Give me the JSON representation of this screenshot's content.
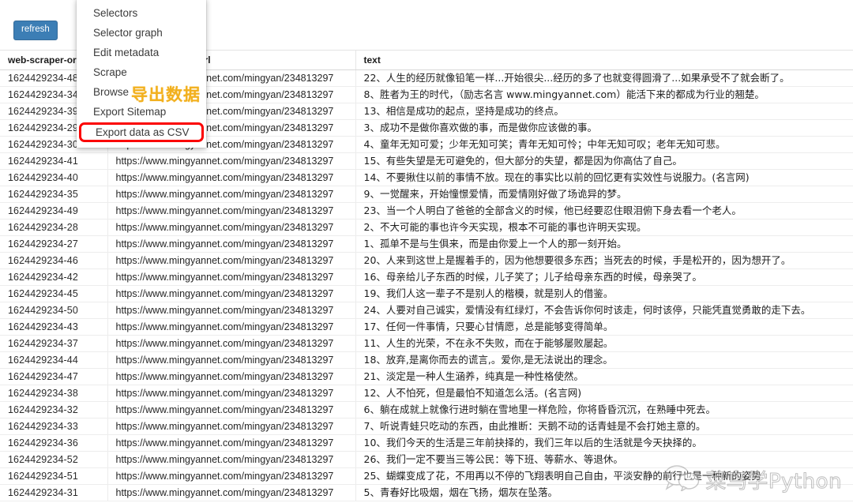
{
  "toolbar": {
    "refresh_label": "refresh"
  },
  "context_menu": {
    "items": [
      {
        "label": "Selectors",
        "highlighted": false
      },
      {
        "label": "Selector graph",
        "highlighted": false
      },
      {
        "label": "Edit metadata",
        "highlighted": false
      },
      {
        "label": "Scrape",
        "highlighted": false
      },
      {
        "label": "Browse",
        "highlighted": false
      },
      {
        "label": "Export Sitemap",
        "highlighted": false
      },
      {
        "label": "Export data as CSV",
        "highlighted": true
      }
    ],
    "highlight_color": "#fb0000"
  },
  "annotation": {
    "text": "导出数据",
    "color": "#f2b01e"
  },
  "watermark": {
    "text": "菜鸟学Python",
    "icon": "wechat-icon"
  },
  "table": {
    "columns": [
      "web-scraper-order",
      "web-scraper-start-url",
      "text"
    ],
    "rows": [
      {
        "id": "1624429234-48",
        "url": "https://www.mingyannet.com/mingyan/234813297",
        "text": "22、人生的经历就像铅笔一样...开始很尖...经历的多了也就变得圆滑了...如果承受不了就会断了。"
      },
      {
        "id": "1624429234-34",
        "url": "https://www.mingyannet.com/mingyan/234813297",
        "text": "8、胜者为王的时代，（励志名言 www.mingyannet.com）能活下来的都成为行业的翘楚。"
      },
      {
        "id": "1624429234-39",
        "url": "https://www.mingyannet.com/mingyan/234813297",
        "text": "13、相信是成功的起点，坚持是成功的终点。"
      },
      {
        "id": "1624429234-29",
        "url": "https://www.mingyannet.com/mingyan/234813297",
        "text": "3、成功不是做你喜欢做的事，而是做你应该做的事。"
      },
      {
        "id": "1624429234-30",
        "url": "https://www.mingyannet.com/mingyan/234813297",
        "text": "4、童年无知可爱；少年无知可笑；青年无知可怜；中年无知可叹；老年无知可悲。"
      },
      {
        "id": "1624429234-41",
        "url": "https://www.mingyannet.com/mingyan/234813297",
        "text": "15、有些失望是无可避免的，但大部分的失望，都是因为你高估了自己。"
      },
      {
        "id": "1624429234-40",
        "url": "https://www.mingyannet.com/mingyan/234813297",
        "text": "14、不要揪住以前的事情不放。现在的事实比以前的回忆更有实效性与说服力。(名言网)"
      },
      {
        "id": "1624429234-35",
        "url": "https://www.mingyannet.com/mingyan/234813297",
        "text": "9、一觉醒来，开始憧憬爱情，而爱情刚好做了场诡异的梦。"
      },
      {
        "id": "1624429234-49",
        "url": "https://www.mingyannet.com/mingyan/234813297",
        "text": "23、当一个人明白了爸爸的全部含义的时候，他已经要忍住眼泪俯下身去看一个老人。"
      },
      {
        "id": "1624429234-28",
        "url": "https://www.mingyannet.com/mingyan/234813297",
        "text": "2、不大可能的事也许今天实现，根本不可能的事也许明天实现。"
      },
      {
        "id": "1624429234-27",
        "url": "https://www.mingyannet.com/mingyan/234813297",
        "text": "1、孤单不是与生俱来，而是由你爱上一个人的那一刻开始。"
      },
      {
        "id": "1624429234-46",
        "url": "https://www.mingyannet.com/mingyan/234813297",
        "text": "20、人来到这世上是握着手的，因为他想要很多东西；当死去的时候，手是松开的，因为想开了。"
      },
      {
        "id": "1624429234-42",
        "url": "https://www.mingyannet.com/mingyan/234813297",
        "text": "16、母亲给儿子东西的时候，儿子笑了；儿子给母亲东西的时候，母亲哭了。"
      },
      {
        "id": "1624429234-45",
        "url": "https://www.mingyannet.com/mingyan/234813297",
        "text": "19、我们人这一辈子不是别人的楷模，就是别人的借鉴。"
      },
      {
        "id": "1624429234-50",
        "url": "https://www.mingyannet.com/mingyan/234813297",
        "text": "24、人要对自己诚实，爱情没有红绿灯，不会告诉你何时该走，何时该停，只能凭直觉勇敢的走下去。"
      },
      {
        "id": "1624429234-43",
        "url": "https://www.mingyannet.com/mingyan/234813297",
        "text": "17、任何一件事情，只要心甘情愿，总是能够变得简单。"
      },
      {
        "id": "1624429234-37",
        "url": "https://www.mingyannet.com/mingyan/234813297",
        "text": "11、人生的光荣，不在永不失败，而在于能够屡败屡起。"
      },
      {
        "id": "1624429234-44",
        "url": "https://www.mingyannet.com/mingyan/234813297",
        "text": "18、放弃,是离你而去的谎言,。爱你,是无法说出的理念。"
      },
      {
        "id": "1624429234-47",
        "url": "https://www.mingyannet.com/mingyan/234813297",
        "text": "21、淡定是一种人生涵养，纯真是一种性格使然。"
      },
      {
        "id": "1624429234-38",
        "url": "https://www.mingyannet.com/mingyan/234813297",
        "text": "12、人不怕死，但是最怕不知道怎么活。(名言网)"
      },
      {
        "id": "1624429234-32",
        "url": "https://www.mingyannet.com/mingyan/234813297",
        "text": "6、躺在成就上就像行进时躺在雪地里一样危险，你将昏昏沉沉，在熟睡中死去。"
      },
      {
        "id": "1624429234-33",
        "url": "https://www.mingyannet.com/mingyan/234813297",
        "text": "7、听说青蛙只吃动的东西，由此推断：天鹅不动的话青蛙是不会打她主意的。"
      },
      {
        "id": "1624429234-36",
        "url": "https://www.mingyannet.com/mingyan/234813297",
        "text": "10、我们今天的生活是三年前抉择的，我们三年以后的生活就是今天抉择的。"
      },
      {
        "id": "1624429234-52",
        "url": "https://www.mingyannet.com/mingyan/234813297",
        "text": "26、我们一定不要当三等公民：等下班、等薪水、等退休。"
      },
      {
        "id": "1624429234-51",
        "url": "https://www.mingyannet.com/mingyan/234813297",
        "text": "25、蝴蝶变成了花，不用再以不停的飞翔表明自己自由，平淡安静的前行也是一种新的姿势"
      },
      {
        "id": "1624429234-31",
        "url": "https://www.mingyannet.com/mingyan/234813297",
        "text": "5、青春好比吸烟，烟在飞扬，烟灰在坠落。"
      }
    ]
  }
}
